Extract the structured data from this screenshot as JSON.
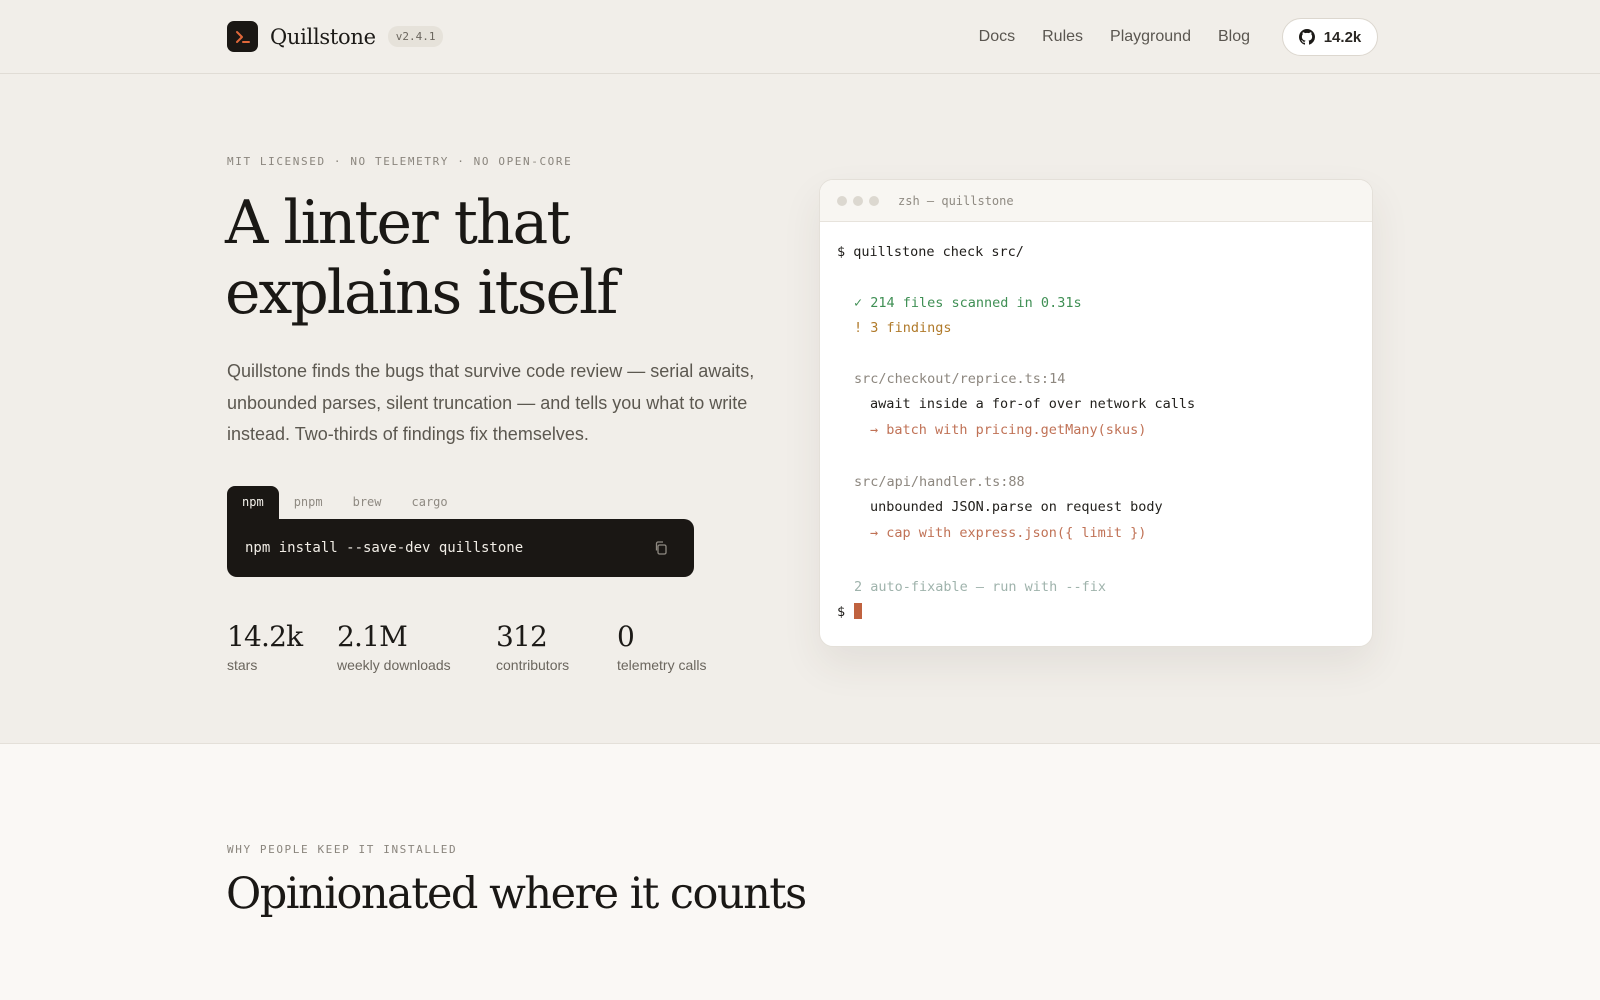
{
  "header": {
    "brand_name": "Quillstone",
    "version": "v2.4.1",
    "nav": [
      "Docs",
      "Rules",
      "Playground",
      "Blog"
    ],
    "github_stars": "14.2k"
  },
  "hero": {
    "eyebrow": "MIT LICENSED · NO TELEMETRY · NO OPEN-CORE",
    "title_line1": "A linter that",
    "title_line2": "explains itself",
    "description": "Quillstone finds the bugs that survive code review — serial awaits, unbounded parses, silent truncation — and tells you what to write instead. Two-thirds of findings fix themselves.",
    "install_tabs": [
      "npm",
      "pnpm",
      "brew",
      "cargo"
    ],
    "active_tab": "npm",
    "install_command": "npm install --save-dev quillstone",
    "stats": [
      {
        "value": "14.2k",
        "label": "stars"
      },
      {
        "value": "2.1M",
        "label": "weekly downloads"
      },
      {
        "value": "312",
        "label": "contributors"
      },
      {
        "value": "0",
        "label": "telemetry calls"
      }
    ]
  },
  "terminal": {
    "title": "zsh — quillstone",
    "lines": [
      {
        "text": "$ quillstone check src/",
        "style": "cmd"
      },
      {
        "text": "✓ 214 files scanned in 0.31s",
        "style": "ok"
      },
      {
        "text": "! 3 findings",
        "style": "warn"
      },
      {
        "text": "src/checkout/reprice.ts:14",
        "style": "path"
      },
      {
        "text": "await inside a for-of over network calls",
        "style": "msg"
      },
      {
        "text": "→ batch with pricing.getMany(skus)",
        "style": "fix"
      },
      {
        "text": "src/api/handler.ts:88",
        "style": "path"
      },
      {
        "text": "unbounded JSON.parse on request body",
        "style": "msg"
      },
      {
        "text": "→ cap with express.json({ limit })",
        "style": "fix"
      },
      {
        "text": "2 auto-fixable — run with --fix",
        "style": "dim"
      },
      {
        "text": "$",
        "style": "cmd"
      }
    ]
  },
  "section2": {
    "eyebrow": "WHY PEOPLE KEEP IT INSTALLED",
    "title": "Opinionated where it counts"
  },
  "colors": {
    "background": "#f1eee9",
    "dark": "#1a1714",
    "accent": "#e0673a",
    "ok": "#3f8f54",
    "warn": "#b07a2a",
    "fix": "#c07256"
  },
  "icons": {
    "logo": "terminal-prompt-icon",
    "github": "github-icon",
    "copy": "copy-icon"
  }
}
